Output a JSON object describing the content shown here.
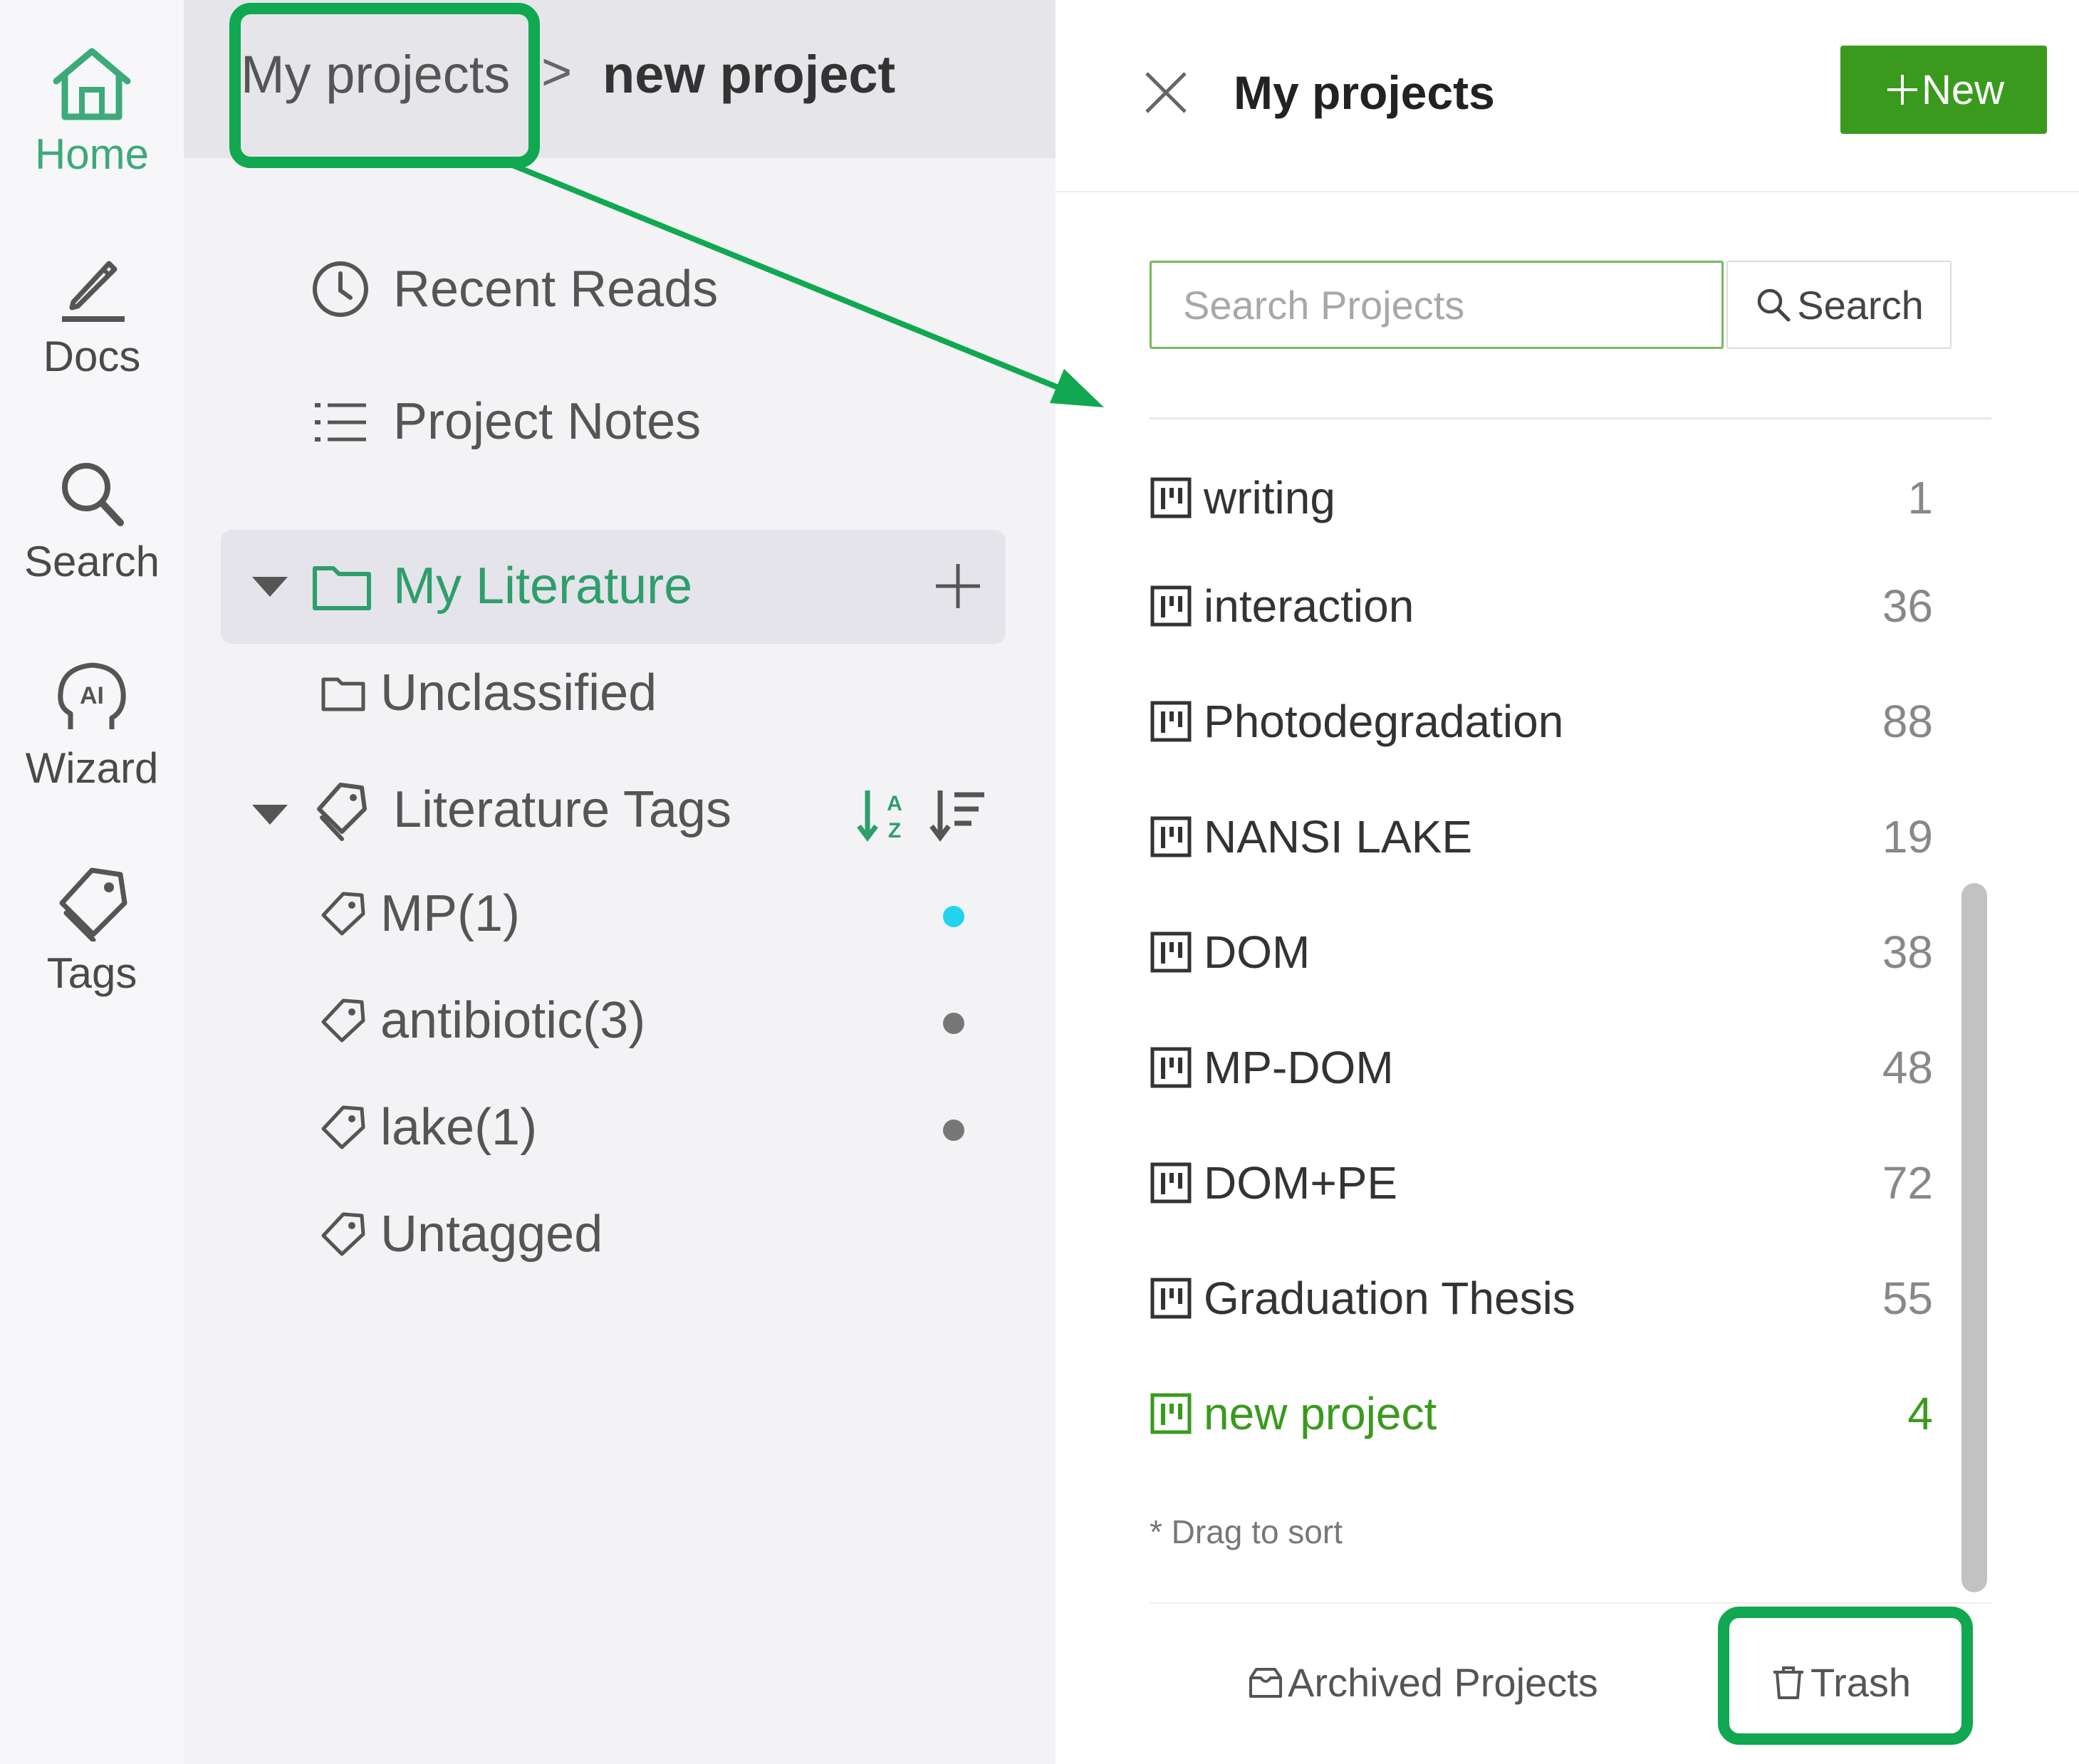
{
  "rail": {
    "items": [
      {
        "label": "Home",
        "icon": "home-icon",
        "active": true
      },
      {
        "label": "Docs",
        "icon": "pen-icon"
      },
      {
        "label": "Search",
        "icon": "search-icon"
      },
      {
        "label": "Wizard",
        "icon": "ai-wizard-icon"
      },
      {
        "label": "Tags",
        "icon": "tags-icon"
      }
    ]
  },
  "breadcrumb": {
    "root": "My projects",
    "separator": ">",
    "current": "new project"
  },
  "nav": {
    "recent_reads": "Recent Reads",
    "project_notes": "Project Notes",
    "my_literature": "My Literature",
    "unclassified": "Unclassified",
    "literature_tags": "Literature Tags",
    "tags": [
      {
        "label": "MP(1)",
        "dot_color": "#22d3ee"
      },
      {
        "label": "antibiotic(3)",
        "dot_color": "#777777"
      },
      {
        "label": "lake(1)",
        "dot_color": "#777777"
      },
      {
        "label": "Untagged"
      }
    ]
  },
  "panel": {
    "title": "My projects",
    "new_button": "New",
    "search_placeholder": "Search Projects",
    "search_button": "Search",
    "projects": [
      {
        "name": "writing",
        "count": "1"
      },
      {
        "name": "interaction",
        "count": "36"
      },
      {
        "name": "Photodegradation",
        "count": "88"
      },
      {
        "name": "NANSI LAKE",
        "count": "19"
      },
      {
        "name": "DOM",
        "count": "38"
      },
      {
        "name": "MP-DOM",
        "count": "48"
      },
      {
        "name": "DOM+PE",
        "count": "72"
      },
      {
        "name": "Graduation Thesis",
        "count": "55"
      },
      {
        "name": "new project",
        "count": "4",
        "active": true
      }
    ],
    "drag_hint": "* Drag to sort",
    "archived": "Archived Projects",
    "trash": "Trash"
  },
  "colors": {
    "accent_green": "#3a9a1e",
    "highlight_green": "#10a850",
    "rail_active": "#3daa79"
  }
}
